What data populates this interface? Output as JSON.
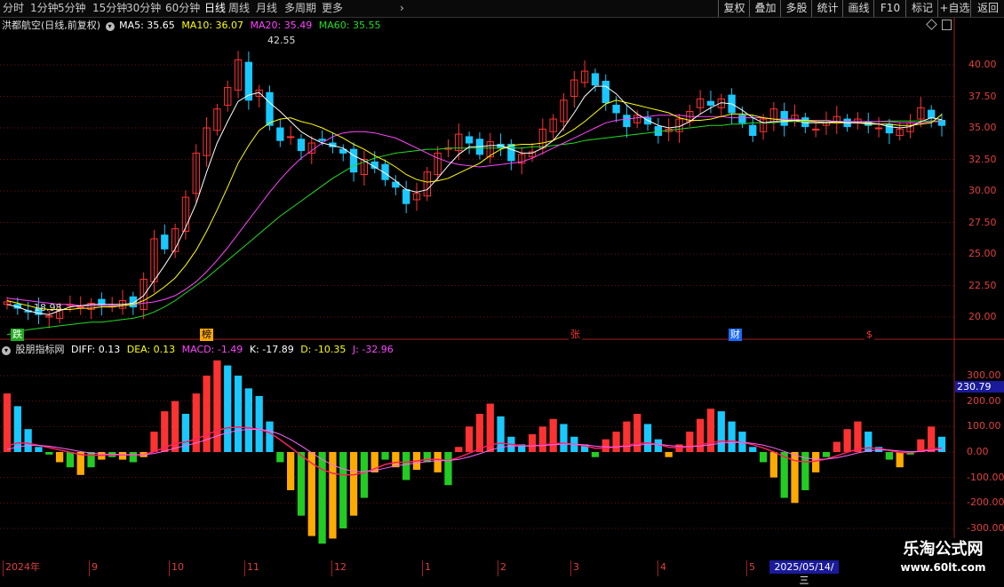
{
  "toolbar": {
    "periods": [
      "分时",
      "1分钟",
      "5分钟",
      "15分钟",
      "30分钟",
      "60分钟",
      "日线",
      "周线",
      "月线",
      "多周期",
      "更多"
    ],
    "active_period": "日线",
    "buttons": [
      "复权",
      "叠加",
      "多股",
      "统计",
      "画线",
      "F10",
      "标记",
      "+自选",
      "返回"
    ]
  },
  "main_header": {
    "stock": "洪都航空(日线,前复权)",
    "ma5": "MA5: 35.65",
    "ma10": "MA10: 36.07",
    "ma20": "MA20: 35.49",
    "ma60": "MA60: 35.55"
  },
  "sub_header": {
    "title": "股朋指标网",
    "diff": "DIFF: 0.13",
    "dea": "DEA: 0.13",
    "macd": "MACD: -1.49",
    "k": "K: -17.89",
    "d": "D: -10.35",
    "j": "J: -32.96"
  },
  "price_axis": [
    "40.00",
    "37.50",
    "35.00",
    "32.50",
    "30.00",
    "27.50",
    "25.00",
    "22.50",
    "20.00"
  ],
  "indicator_axis": [
    "300.00",
    "200.00",
    "100.00",
    "0.00",
    "-100.00",
    "-200.00",
    "-300.00"
  ],
  "indicator_axis_highlight": "230.79",
  "annotations": {
    "high": "42.55",
    "low": "18.98"
  },
  "signals": [
    "跌",
    "榜",
    "张",
    "财",
    "$"
  ],
  "date_axis": [
    "2024年",
    "9",
    "10",
    "11",
    "12",
    "1",
    "2",
    "3",
    "4",
    "5"
  ],
  "cursor_date": "2025/05/14/三",
  "colors": {
    "up": "#ff3232",
    "down": "#19c8ff",
    "ma5": "#ffffff",
    "ma10": "#ffff00",
    "ma20": "#ff44ff",
    "ma60": "#22dd22",
    "axis": "#e04040",
    "histo_neg_a": "#22cc22",
    "histo_neg_b": "#ffaa00"
  },
  "watermark": {
    "name": "乐淘公式网",
    "url": "www.60lt.com"
  },
  "chart_data": {
    "type": "candlestick",
    "title": "洪都航空(日线,前复权)",
    "ylim": [
      18,
      42.8
    ],
    "series": [
      {
        "name": "close",
        "values": [
          21.2,
          20.7,
          20.4,
          20.2,
          20.1,
          20.6,
          21.0,
          20.8,
          21.1,
          21.0,
          20.9,
          21.3,
          20.8,
          23.0,
          26.2,
          25.4,
          27.0,
          29.5,
          33.0,
          35.0,
          36.5,
          38.2,
          40.4,
          37.2,
          38.0,
          35.2,
          34.0,
          34.3,
          33.2,
          33.8,
          34.0,
          33.5,
          33.0,
          31.5,
          32.5,
          31.8,
          30.9,
          30.3,
          29.0,
          29.8,
          31.5,
          33.0,
          33.4,
          34.5,
          33.8,
          32.9,
          33.9,
          33.4,
          32.4,
          32.9,
          33.1,
          34.9,
          35.7,
          37.2,
          38.8,
          39.5,
          38.4,
          37.0,
          36.2,
          35.1,
          36.0,
          35.3,
          34.4,
          34.9,
          35.7,
          36.3,
          37.3,
          36.8,
          37.3,
          36.2,
          35.4,
          34.4,
          35.7,
          36.5,
          35.2,
          36.0,
          35.1,
          34.9,
          35.6,
          35.9,
          35.1,
          35.7,
          35.2,
          35.0,
          34.6,
          34.9,
          35.4,
          36.6,
          35.8,
          35.2
        ]
      },
      {
        "name": "MA5",
        "values": [
          21.0,
          20.8,
          20.5,
          20.3,
          20.2,
          20.5,
          20.8,
          20.9,
          21.0,
          21.0,
          21.0,
          21.0,
          21.1,
          21.7,
          22.9,
          24.1,
          25.4,
          27.1,
          29.0,
          31.5,
          33.8,
          35.5,
          37.1,
          37.6,
          37.8,
          37.0,
          36.3,
          35.5,
          34.7,
          34.2,
          33.8,
          33.6,
          33.4,
          32.8,
          32.4,
          31.9,
          31.4,
          30.8,
          30.1,
          29.9,
          30.1,
          31.0,
          32.0,
          32.9,
          33.5,
          33.5,
          33.6,
          33.6,
          33.3,
          33.0,
          33.0,
          33.4,
          34.0,
          35.0,
          36.2,
          37.5,
          38.3,
          38.3,
          37.7,
          36.8,
          36.1,
          35.6,
          35.2,
          35.0,
          35.1,
          35.5,
          36.1,
          36.6,
          37.0,
          36.9,
          36.4,
          35.8,
          35.4,
          35.5,
          35.5,
          35.6,
          35.4,
          35.4,
          35.4,
          35.5,
          35.4,
          35.4,
          35.4,
          35.3,
          35.1,
          35.0,
          35.1,
          35.5,
          35.8,
          35.65
        ]
      },
      {
        "name": "MA10",
        "values": [
          21.3,
          21.1,
          20.9,
          20.7,
          20.6,
          20.6,
          20.6,
          20.7,
          20.7,
          20.8,
          20.8,
          20.9,
          21.0,
          21.3,
          21.8,
          22.4,
          23.1,
          24.1,
          25.3,
          26.8,
          28.5,
          30.3,
          32.2,
          33.6,
          34.8,
          35.4,
          35.7,
          35.8,
          35.5,
          35.3,
          35.0,
          34.6,
          34.2,
          33.7,
          33.3,
          32.8,
          32.4,
          31.9,
          31.3,
          30.9,
          30.7,
          30.8,
          31.0,
          31.4,
          31.8,
          32.2,
          32.8,
          33.3,
          33.6,
          33.7,
          33.7,
          33.8,
          34.0,
          34.4,
          34.9,
          35.5,
          36.2,
          36.9,
          37.2,
          37.0,
          36.8,
          36.6,
          36.4,
          36.2,
          35.8,
          35.6,
          35.6,
          35.7,
          35.9,
          36.1,
          36.1,
          36.0,
          35.8,
          35.7,
          35.6,
          35.6,
          35.6,
          35.5,
          35.4,
          35.4,
          35.4,
          35.4,
          35.3,
          35.3,
          35.3,
          35.2,
          35.2,
          35.3,
          35.4,
          36.07
        ]
      },
      {
        "name": "MA20",
        "values": [
          21.5,
          21.4,
          21.3,
          21.2,
          21.1,
          21.0,
          21.0,
          20.9,
          20.9,
          20.9,
          20.9,
          20.9,
          21.0,
          21.1,
          21.2,
          21.4,
          21.7,
          22.2,
          22.8,
          23.6,
          24.5,
          25.5,
          26.6,
          27.7,
          28.8,
          29.9,
          30.9,
          31.8,
          32.6,
          33.2,
          33.8,
          34.3,
          34.6,
          34.7,
          34.7,
          34.6,
          34.4,
          34.2,
          33.8,
          33.4,
          33.0,
          32.6,
          32.3,
          32.1,
          32.0,
          31.9,
          32.0,
          32.1,
          32.2,
          32.3,
          32.6,
          33.0,
          33.4,
          33.8,
          34.2,
          34.6,
          35.0,
          35.4,
          35.6,
          35.7,
          35.8,
          35.9,
          36.0,
          36.0,
          36.0,
          35.9,
          35.9,
          35.9,
          35.9,
          35.8,
          35.8,
          35.8,
          35.8,
          35.7,
          35.7,
          35.7,
          35.6,
          35.6,
          35.6,
          35.5,
          35.5,
          35.5,
          35.5,
          35.5,
          35.5,
          35.4,
          35.4,
          35.4,
          35.5,
          35.49
        ]
      },
      {
        "name": "MA60",
        "values": [
          18.6,
          18.8,
          19.0,
          19.1,
          19.2,
          19.3,
          19.4,
          19.5,
          19.6,
          19.6,
          19.7,
          19.8,
          19.9,
          20.1,
          20.4,
          20.8,
          21.3,
          21.9,
          22.5,
          23.1,
          23.8,
          24.5,
          25.2,
          25.9,
          26.6,
          27.3,
          28.0,
          28.6,
          29.2,
          29.8,
          30.4,
          31.0,
          31.5,
          32.0,
          32.3,
          32.6,
          32.8,
          33.0,
          33.1,
          33.2,
          33.3,
          33.3,
          33.4,
          33.4,
          33.4,
          33.4,
          33.4,
          33.4,
          33.4,
          33.4,
          33.5,
          33.5,
          33.6,
          33.7,
          33.8,
          34.0,
          34.1,
          34.2,
          34.3,
          34.4,
          34.5,
          34.6,
          34.7,
          34.8,
          34.9,
          35.0,
          35.1,
          35.2,
          35.2,
          35.3,
          35.3,
          35.4,
          35.4,
          35.4,
          35.5,
          35.5,
          35.5,
          35.5,
          35.5,
          35.5,
          35.5,
          35.5,
          35.5,
          35.5,
          35.55,
          35.55,
          35.55,
          35.55,
          35.55,
          35.55
        ]
      },
      {
        "name": "MACD",
        "values": [
          230,
          180,
          90,
          20,
          -10,
          -40,
          -60,
          -90,
          -60,
          -30,
          -20,
          -30,
          -40,
          -20,
          80,
          160,
          200,
          150,
          230,
          300,
          360,
          340,
          300,
          250,
          220,
          120,
          -40,
          -150,
          -250,
          -330,
          -360,
          -340,
          -300,
          -250,
          -180,
          -80,
          -30,
          -60,
          -110,
          -70,
          -40,
          -80,
          -130,
          20,
          100,
          150,
          190,
          140,
          60,
          30,
          70,
          100,
          130,
          110,
          60,
          30,
          -20,
          50,
          80,
          120,
          150,
          110,
          50,
          -20,
          30,
          80,
          130,
          170,
          160,
          120,
          80,
          20,
          -40,
          -100,
          -180,
          -200,
          -150,
          -80,
          -20,
          40,
          90,
          120,
          80,
          20,
          -30,
          -60,
          -10,
          50,
          100,
          60
        ]
      }
    ]
  }
}
